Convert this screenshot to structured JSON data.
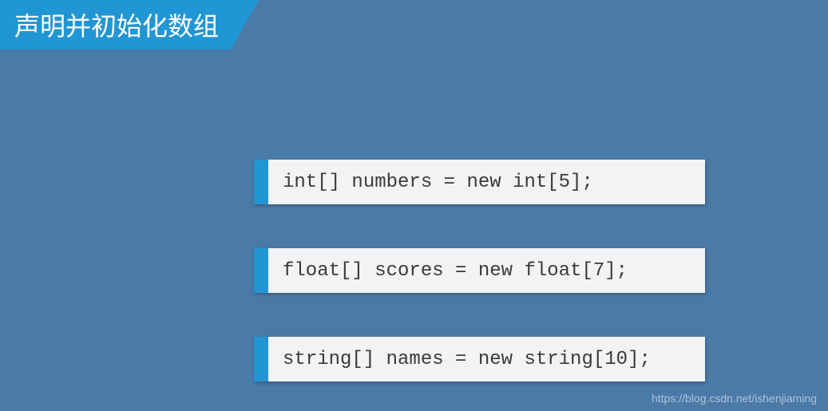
{
  "title": "声明并初始化数组",
  "codeBlocks": [
    {
      "code": "int[] numbers = new int[5];"
    },
    {
      "code": "float[] scores = new float[7];"
    },
    {
      "code": "string[] names = new string[10];"
    }
  ],
  "watermark": "https://blog.csdn.net/ishenjiaming"
}
